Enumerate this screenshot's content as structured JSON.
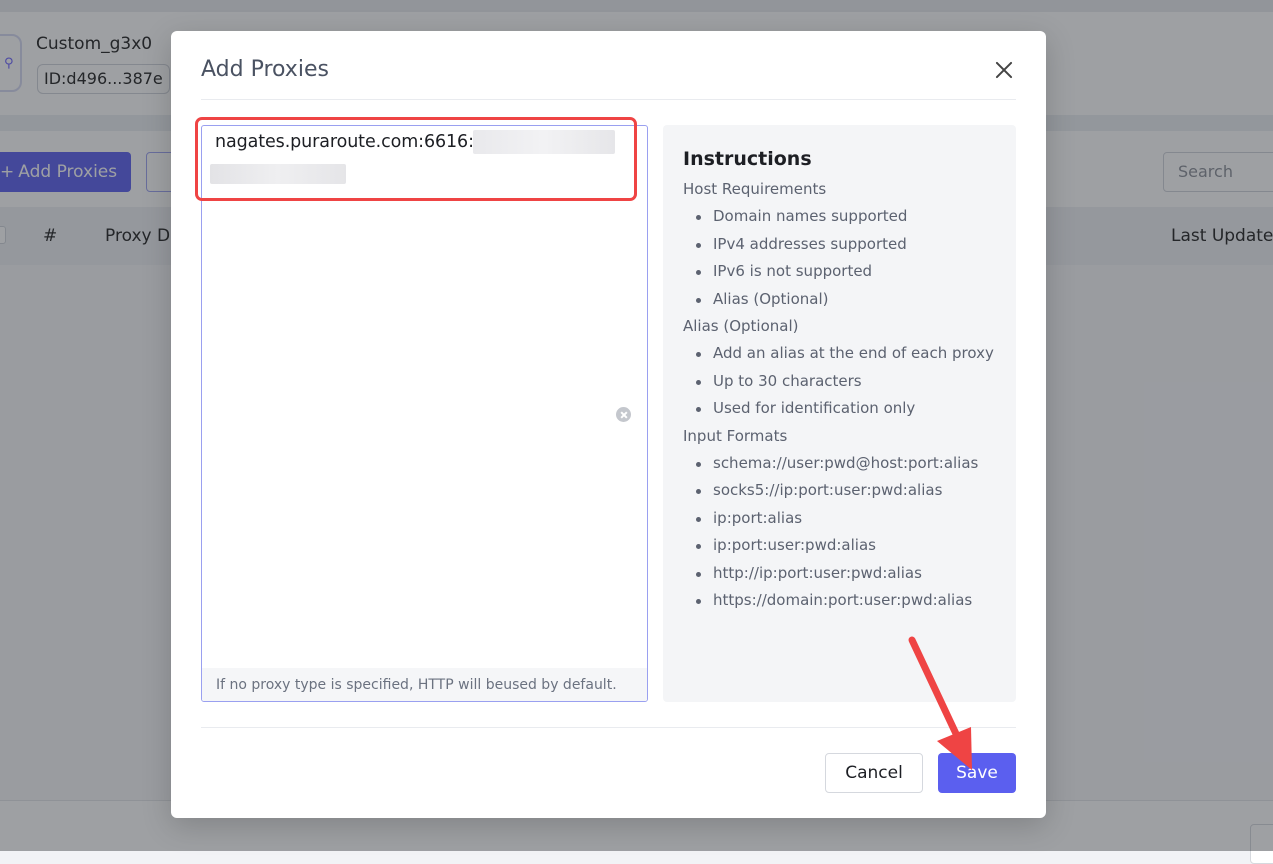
{
  "background": {
    "profile_name": "Custom_g3x0",
    "profile_id": "ID:d496...387e",
    "add_proxies_label": "Add Proxies",
    "search_placeholder": "Search",
    "table_headers": [
      "#",
      "Proxy D",
      "Last Update"
    ]
  },
  "modal": {
    "title": "Add Proxies",
    "proxy_input_value": "nagates.puraroute.com:6616:",
    "proxy_hint": "If no proxy type is specified, HTTP will beused by default.",
    "instructions": {
      "title": "Instructions",
      "sections": [
        {
          "heading": "Host Requirements",
          "items": [
            "Domain names supported",
            "IPv4 addresses supported",
            "IPv6 is not supported",
            "Alias (Optional)"
          ]
        },
        {
          "heading": "Alias (Optional)",
          "items": [
            "Add an alias at the end of each proxy",
            "Up to 30 characters",
            "Used for identification only"
          ]
        },
        {
          "heading": "Input Formats",
          "items": [
            "schema://user:pwd@host:port:alias",
            "socks5://ip:port:user:pwd:alias",
            "ip:port:alias",
            "ip:port:user:pwd:alias",
            "http://ip:port:user:pwd:alias",
            "https://domain:port:user:pwd:alias"
          ]
        }
      ]
    },
    "cancel_label": "Cancel",
    "save_label": "Save"
  },
  "colors": {
    "primary": "#5b5fef",
    "annotation": "#ef4444"
  },
  "icons": [
    "close-icon",
    "clear-icon",
    "plus-icon",
    "avatar-icon"
  ]
}
